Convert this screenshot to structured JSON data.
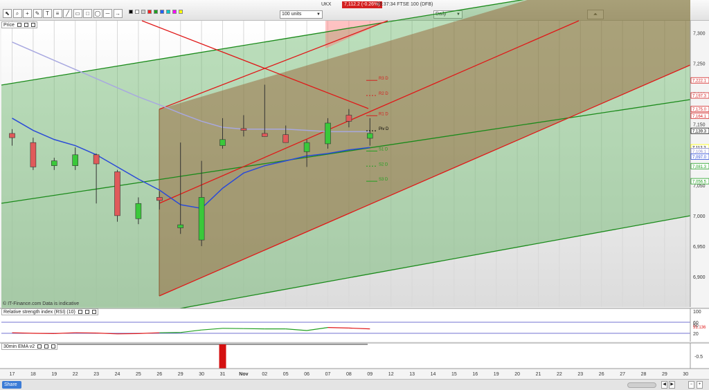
{
  "toolbar": {
    "icons": [
      "select-icon",
      "zoom-icon",
      "crosshair-icon",
      "pencil-icon",
      "text-icon",
      "fibonacci-icon",
      "trendline-icon",
      "channel-icon",
      "rectangle-icon",
      "ellipse-icon",
      "line-icon",
      "arrow-icon"
    ],
    "swatches": [
      "#000000",
      "#ffffff",
      "#d0d0d0",
      "#ff2020",
      "#20a020",
      "#2060ff",
      "#00c8c8",
      "#ff00ff",
      "#ffff00"
    ],
    "units_select": "100 units",
    "period_select": "Daily",
    "info": "UKX",
    "price": "7,112.2 (-0.26%)",
    "quote_info": "06:37:34 FTSE 100 (DFB)"
  },
  "panels": {
    "price_title": "Price",
    "rsi_title": "Relative strength index (RSI) (10)",
    "ema_title": "30min EMA v2",
    "disclaimer": "© IT-Finance.com  Data is indicative"
  },
  "footer": {
    "share_label": "Share"
  },
  "chart_data": {
    "type": "candlestick",
    "x": [
      "17",
      "18",
      "19",
      "22",
      "23",
      "24",
      "25",
      "26",
      "29",
      "30",
      "31",
      "01",
      "02",
      "05",
      "06",
      "07",
      "08",
      "09"
    ],
    "x_axis_labels": [
      "17",
      "18",
      "19",
      "22",
      "23",
      "24",
      "25",
      "26",
      "29",
      "30",
      "31",
      "Nov",
      "02",
      "05",
      "06",
      "07",
      "08",
      "09",
      "12",
      "13",
      "14",
      "15",
      "16",
      "19",
      "20",
      "21",
      "22",
      "23",
      "26",
      "27",
      "28",
      "29",
      "30"
    ],
    "ohlc": [
      [
        7135,
        7142,
        7115,
        7128
      ],
      [
        7120,
        7128,
        7075,
        7080
      ],
      [
        7082,
        7095,
        7075,
        7090
      ],
      [
        7082,
        7112,
        7075,
        7100
      ],
      [
        7100,
        7102,
        7020,
        7085
      ],
      [
        7072,
        7075,
        6990,
        7000
      ],
      [
        6995,
        7030,
        6986,
        7020
      ],
      [
        7030,
        7040,
        7010,
        7025
      ],
      [
        6980,
        7120,
        6970,
        6985
      ],
      [
        6960,
        7090,
        6950,
        7030
      ],
      [
        7115,
        7160,
        7110,
        7125
      ],
      [
        7143,
        7165,
        7130,
        7140
      ],
      [
        7135,
        7215,
        7130,
        7130
      ],
      [
        7133,
        7148,
        7120,
        7120
      ],
      [
        7105,
        7125,
        7080,
        7120
      ],
      [
        7118,
        7160,
        7110,
        7152
      ],
      [
        7165,
        7175,
        7145,
        7155
      ],
      [
        7127,
        7160,
        7115,
        7135
      ]
    ],
    "price_axis": {
      "ticks": [
        7300,
        7250,
        7200,
        7150,
        7100,
        7050,
        7000,
        6950,
        6900
      ],
      "labels": [
        "7,300",
        "7,250",
        "7,200",
        "7,150",
        "7,100",
        "7,050",
        "7,000",
        "6,950",
        "6,900"
      ],
      "range": [
        6850,
        7320
      ]
    },
    "right_price_labels": [
      {
        "label": "7,222.1",
        "value": 7222.1,
        "color": "#d42020"
      },
      {
        "label": "7,197.3",
        "value": 7197.3,
        "color": "#d42020"
      },
      {
        "label": "7,175.0",
        "value": 7175.0,
        "color": "#d42020"
      },
      {
        "label": "7,164.1",
        "value": 7164.1,
        "color": "#d42020"
      },
      {
        "label": "7,139.3",
        "value": 7139.3,
        "color": "#000000"
      },
      {
        "label": "7,112.2",
        "value": 7112.2,
        "color": "#ffff00"
      },
      {
        "label": "7,106.1",
        "value": 7106.1,
        "color": "#8a8ac8"
      },
      {
        "label": "7,097.0",
        "value": 7097.0,
        "color": "#2a4ad8"
      },
      {
        "label": "7,081.3",
        "value": 7081.3,
        "color": "#20a020"
      },
      {
        "label": "7,056.5",
        "value": 7056.5,
        "color": "#20a020"
      }
    ],
    "pivots": [
      {
        "label": "R3 D",
        "value": 7222.1,
        "color": "#d42020"
      },
      {
        "label": "R2 D",
        "value": 7197.3,
        "color": "#d42020"
      },
      {
        "label": "R1 D",
        "value": 7164.1,
        "color": "#d42020"
      },
      {
        "label": "Piv D",
        "value": 7139.3,
        "color": "#000000"
      },
      {
        "label": "S1 D",
        "value": 7106.1,
        "color": "#20a020"
      },
      {
        "label": "S2 D",
        "value": 7081.3,
        "color": "#20a020"
      },
      {
        "label": "S3 D",
        "value": 7056.5,
        "color": "#20a020"
      }
    ],
    "ma_slow": [
      7285,
      7270,
      7255,
      7240,
      7225,
      7210,
      7195,
      7182,
      7168,
      7155,
      7145,
      7142,
      7142,
      7142,
      7140,
      7138,
      7138,
      7138
    ],
    "ma_fast": [
      7160,
      7140,
      7125,
      7115,
      7100,
      7080,
      7060,
      7042,
      7018,
      7012,
      7045,
      7070,
      7082,
      7090,
      7098,
      7102,
      7108,
      7112
    ],
    "rsi": {
      "ticks": [
        100,
        60,
        50,
        20
      ],
      "labels": [
        "100",
        "60",
        "50",
        "20"
      ],
      "range": [
        0,
        100
      ],
      "current_label": "51.136",
      "values": [
        22,
        20,
        19,
        22,
        21,
        18,
        19,
        22,
        23,
        32,
        38,
        37,
        36,
        36,
        30,
        41,
        39,
        36
      ]
    },
    "ema": {
      "ticks": [
        -0.5
      ],
      "labels": [
        "-0.5"
      ]
    },
    "colors": {
      "up": "#3ac83a",
      "down": "#e05a5a",
      "ma_fast": "#2a4ad8",
      "ma_slow": "#a8a8e0",
      "channel_red": "#e01818",
      "channel_green": "#1a8a1a"
    }
  }
}
